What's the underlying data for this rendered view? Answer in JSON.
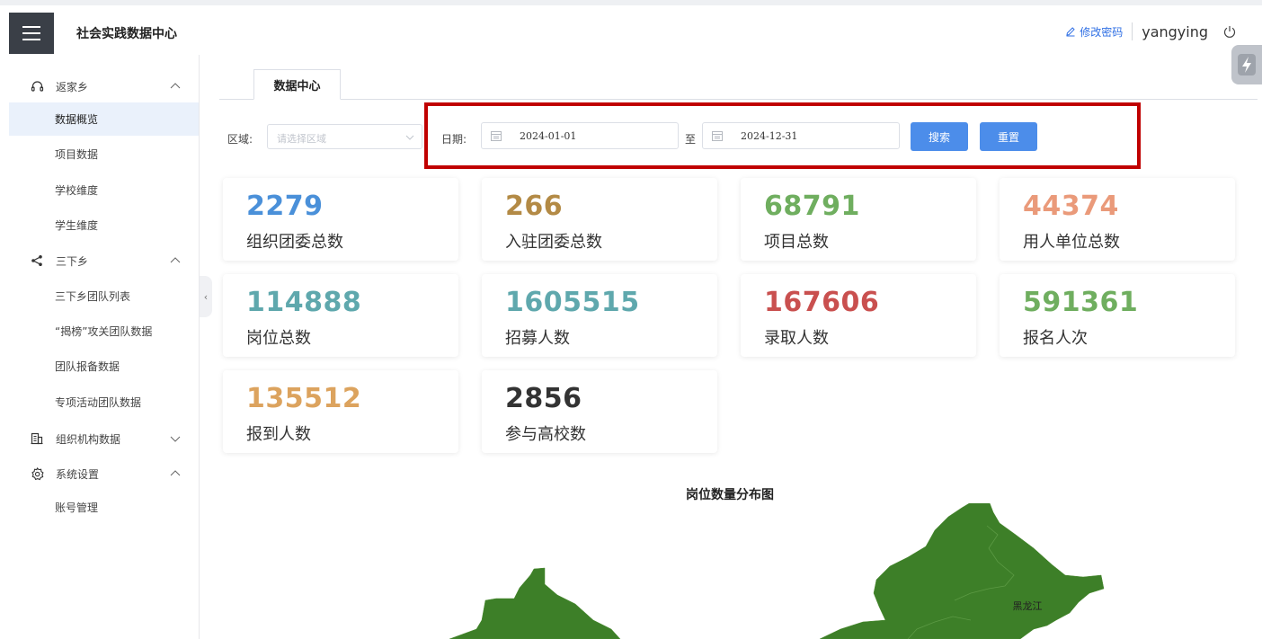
{
  "header": {
    "app_title": "社会实践数据中心",
    "change_password": "修改密码",
    "username": "yangying"
  },
  "sidebar": {
    "groups": [
      {
        "label": "返家乡",
        "icon": "headset-icon",
        "expanded": true
      },
      {
        "label": "三下乡",
        "icon": "share-icon",
        "expanded": true
      },
      {
        "label": "组织机构数据",
        "icon": "building-icon",
        "expanded": false
      },
      {
        "label": "系统设置",
        "icon": "gear-icon",
        "expanded": true
      }
    ],
    "items": [
      {
        "label": "数据概览",
        "active": true
      },
      {
        "label": "项目数据"
      },
      {
        "label": "学校维度"
      },
      {
        "label": "学生维度"
      },
      {
        "label": "三下乡团队列表"
      },
      {
        "label": "“揭榜”攻关团队数据"
      },
      {
        "label": "团队报备数据"
      },
      {
        "label": "专项活动团队数据"
      },
      {
        "label": "账号管理"
      }
    ]
  },
  "tabs": [
    {
      "label": "数据中心",
      "active": true
    }
  ],
  "filters": {
    "region_label": "区域:",
    "region_placeholder": "请选择区域",
    "date_label": "日期:",
    "start_date": "2024-01-01",
    "to_label": "至",
    "end_date": "2024-12-31",
    "search_button": "搜索",
    "reset_button": "重置"
  },
  "stats": [
    {
      "value": "2279",
      "label": "组织团委总数",
      "color": "#4a90d9"
    },
    {
      "value": "266",
      "label": "入驻团委总数",
      "color": "#b38a45"
    },
    {
      "value": "68791",
      "label": "项目总数",
      "color": "#6fae5f"
    },
    {
      "value": "44374",
      "label": "用人单位总数",
      "color": "#ea9a7a"
    },
    {
      "value": "114888",
      "label": "岗位总数",
      "color": "#5fa8ad"
    },
    {
      "value": "1605515",
      "label": "招募人数",
      "color": "#5fa8ad"
    },
    {
      "value": "167606",
      "label": "录取人数",
      "color": "#c9504f"
    },
    {
      "value": "591361",
      "label": "报名人次",
      "color": "#6fae5f"
    },
    {
      "value": "135512",
      "label": "报到人数",
      "color": "#dca35e"
    },
    {
      "value": "2856",
      "label": "参与高校数",
      "color": "#333333"
    }
  ],
  "map": {
    "title": "岗位数量分布图",
    "region_label": "黑龙江",
    "fill_color": "#3d7f28"
  }
}
